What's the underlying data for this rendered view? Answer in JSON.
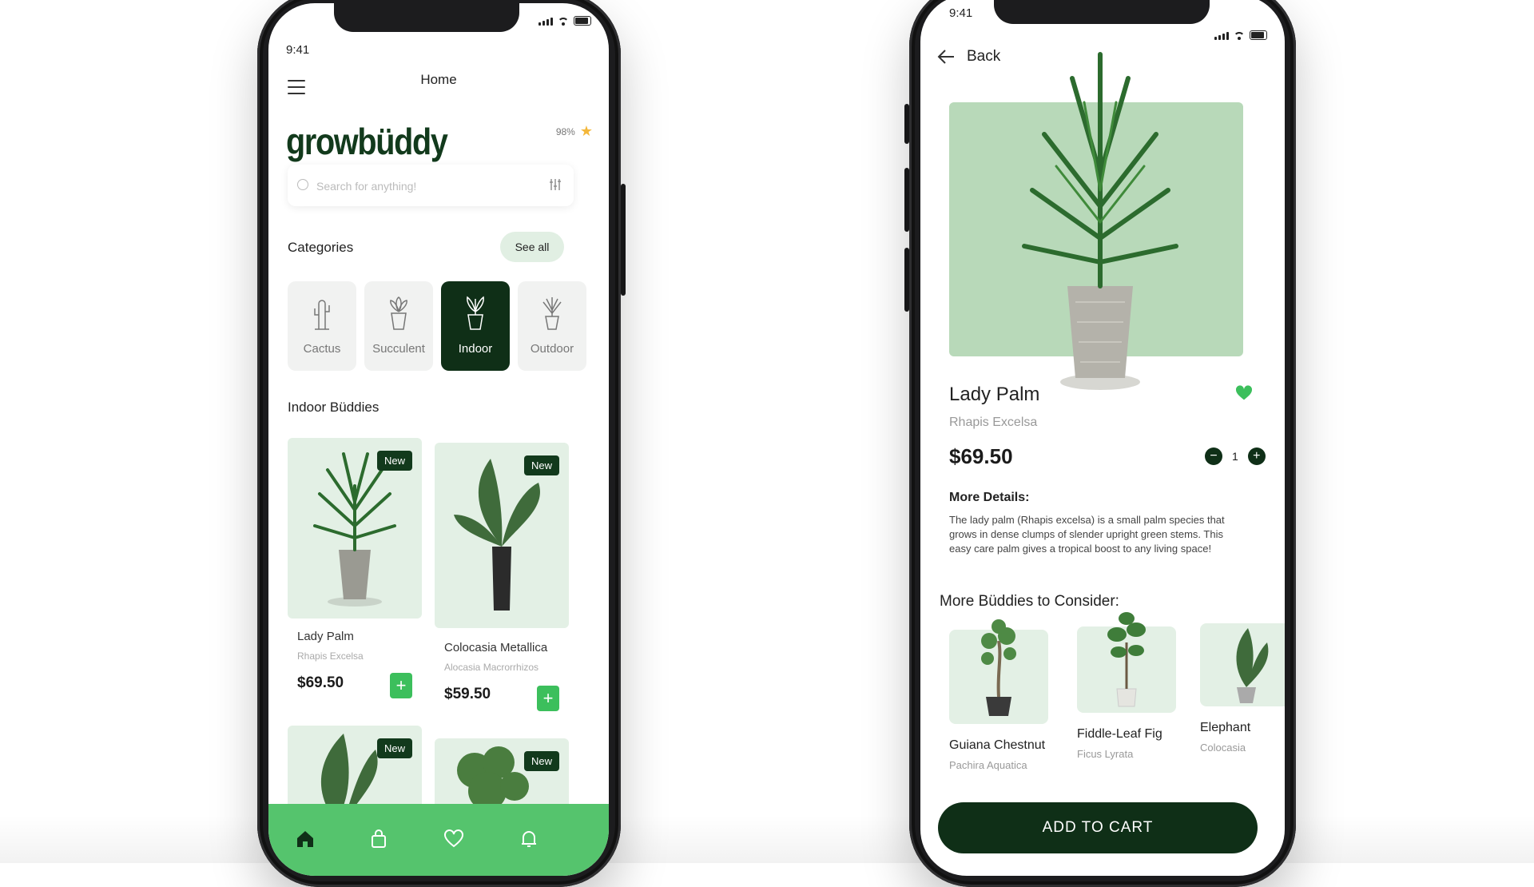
{
  "left_phone": {
    "status_time": "9:41",
    "header_title": "Home",
    "logo": "growbüddy",
    "rating": "98%",
    "search_placeholder": "Search for anything!",
    "categories_title": "Categories",
    "see_all_label": "See all",
    "categories": [
      {
        "label": "Cactus",
        "active": false,
        "icon": "cactus-icon"
      },
      {
        "label": "Succulent",
        "active": false,
        "icon": "succulent-icon"
      },
      {
        "label": "Indoor",
        "active": true,
        "icon": "indoor-plant-icon"
      },
      {
        "label": "Outdoor",
        "active": false,
        "icon": "outdoor-plant-icon"
      }
    ],
    "section_title": "Indoor Büddies",
    "badge_label": "New",
    "products": [
      {
        "name": "Lady Palm",
        "scientific": "Rhapis Excelsa",
        "price": "$69.50"
      },
      {
        "name": "Colocasia Metallica",
        "scientific": "Alocasia Macrorrhizos",
        "price": "$59.50"
      }
    ],
    "nav": [
      "home-icon",
      "bag-icon",
      "heart-icon",
      "bell-icon"
    ],
    "accent": "#55c46d",
    "dark": "#0f2f17"
  },
  "right_phone": {
    "status_time": "9:41",
    "back_label": "Back",
    "product": {
      "name": "Lady Palm",
      "scientific": "Rhapis Excelsa",
      "price": "$69.50",
      "quantity": "1",
      "favorite": true
    },
    "more_details_title": "More Details:",
    "more_details_text": "The lady palm (Rhapis excelsa) is a small palm species that grows in dense clumps of slender upright green stems. This easy care palm gives a tropical boost to any living space!",
    "consider_title": "More Büddies to Consider:",
    "suggestions": [
      {
        "name": "Guiana Chestnut",
        "scientific": "Pachira Aquatica"
      },
      {
        "name": "Fiddle-Leaf Fig",
        "scientific": "Ficus Lyrata"
      },
      {
        "name": "Elephant",
        "scientific": "Colocasia"
      }
    ],
    "cta_label": "ADD TO CART"
  }
}
